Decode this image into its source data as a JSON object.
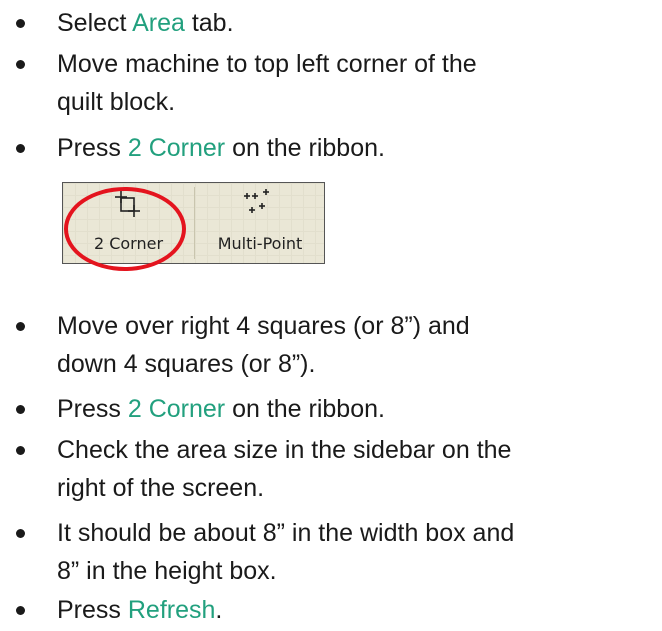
{
  "instructions": [
    {
      "lines": [
        [
          {
            "t": "Select "
          },
          {
            "t": "Area",
            "hl": true
          },
          {
            "t": " tab."
          }
        ]
      ]
    },
    {
      "lines": [
        [
          {
            "t": "Move machine to top left corner of the"
          }
        ],
        [
          {
            "t": "quilt block."
          }
        ]
      ]
    },
    {
      "lines": [
        [
          {
            "t": "Press "
          },
          {
            "t": "2 Corner",
            "hl": true
          },
          {
            "t": " on the ribbon."
          }
        ]
      ]
    },
    {
      "lines": [
        [
          {
            "t": "Move over right 4 squares (or 8”) and"
          }
        ],
        [
          {
            "t": "down 4 squares (or 8”)."
          }
        ]
      ]
    },
    {
      "lines": [
        [
          {
            "t": "Press "
          },
          {
            "t": "2 Corner",
            "hl": true
          },
          {
            "t": " on the ribbon."
          }
        ]
      ]
    },
    {
      "lines": [
        [
          {
            "t": "Check the area size in the sidebar on the"
          }
        ],
        [
          {
            "t": "right of the screen."
          }
        ]
      ]
    },
    {
      "lines": [
        [
          {
            "t": " It should be about 8” in the width box and"
          }
        ],
        [
          {
            "t": "8” in the height box."
          }
        ]
      ]
    },
    {
      "lines": [
        [
          {
            "t": "Press "
          },
          {
            "t": "Refresh",
            "hl": true
          },
          {
            "t": "."
          }
        ]
      ]
    }
  ],
  "ribbon": {
    "buttons": [
      {
        "label": "2 Corner",
        "icon": "two-corner-icon",
        "highlighted": true
      },
      {
        "label": "Multi-Point",
        "icon": "multi-point-icon",
        "highlighted": false
      }
    ],
    "highlight_color": "#e4141e"
  },
  "colors": {
    "text": "#1a1a1a",
    "highlight": "#22a07e",
    "ribbon_bg": "#eae7d6"
  }
}
